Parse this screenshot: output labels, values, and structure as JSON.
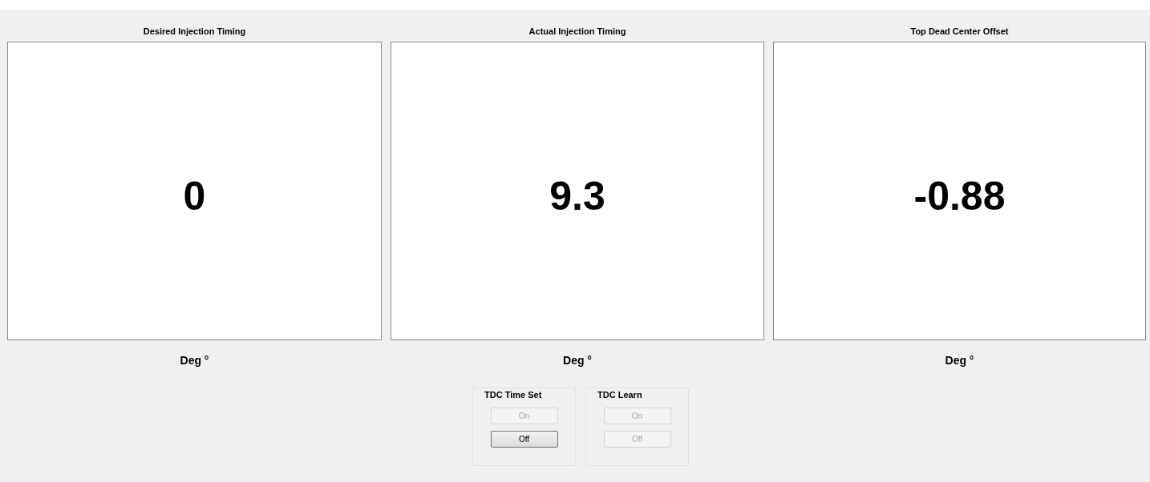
{
  "gauges": [
    {
      "title": "Desired Injection Timing",
      "value": "0",
      "unit": "Deg °"
    },
    {
      "title": "Actual Injection Timing",
      "value": "9.3",
      "unit": "Deg °"
    },
    {
      "title": "Top Dead Center Offset",
      "value": "-0.88",
      "unit": "Deg °"
    }
  ],
  "groups": [
    {
      "title": "TDC Time Set",
      "buttons": [
        {
          "label": "On",
          "disabled": true
        },
        {
          "label": "Off",
          "disabled": false
        }
      ]
    },
    {
      "title": "TDC Learn",
      "buttons": [
        {
          "label": "On",
          "disabled": true
        },
        {
          "label": "Off",
          "disabled": true
        }
      ]
    }
  ]
}
